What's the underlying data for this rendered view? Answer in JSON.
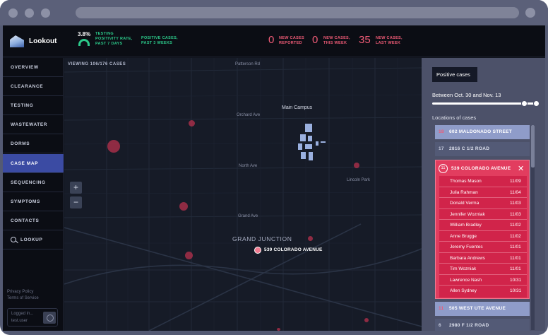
{
  "app": {
    "name": "Lookout"
  },
  "stats": {
    "positivity_value": "3.8%",
    "positivity_label": "TESTING POSITIVITY RATE, PAST 7 DAYS",
    "positive_cases_label": "POSITIVE CASES, PAST 3 WEEKS",
    "new_reported": {
      "value": "0",
      "label": "NEW CASES REPORTED"
    },
    "new_this_week": {
      "value": "0",
      "label": "NEW CASES, THIS WEEK"
    },
    "new_last_week": {
      "value": "35",
      "label": "NEW CASES, LAST WEEK"
    }
  },
  "nav": {
    "overview": "OVERVIEW",
    "clearance": "CLEARANCE",
    "testing": "TESTING",
    "wastewater": "WASTEWATER",
    "dorms": "DORMS",
    "case_map": "CASE MAP",
    "sequencing": "SEQUENCING",
    "symptoms": "SYMPTOMS",
    "contacts": "CONTACTS",
    "lookup": "LOOKUP",
    "active": "case_map"
  },
  "footer": {
    "privacy": "Privacy Policy",
    "terms": "Terms of Service",
    "logged_in": "Logged in...",
    "user": "test.user"
  },
  "map": {
    "viewing": "VIEWING 106/176 CASES",
    "streets": {
      "patterson": "Patterson Rd",
      "orchard": "Orchard Ave",
      "north": "North Ave",
      "lincoln": "Lincoln Park",
      "grand": "Grand Ave"
    },
    "main_campus": "Main Campus",
    "city": "GRAND JUNCTION",
    "selected_location": "539 COLORADO AVENUE",
    "zoom_in": "+",
    "zoom_out": "−"
  },
  "panel": {
    "tab": "Positive cases",
    "range": "Between Oct. 30 and Nov. 13",
    "locations_title": "Locations of cases",
    "rows": [
      {
        "count": "18",
        "name": "602 MALDONADO STREET"
      },
      {
        "count": "17",
        "name": "2816 C 1/2 ROAD"
      },
      {
        "count": "11",
        "name": "505 WEST UTE AVENUE"
      },
      {
        "count": "6",
        "name": "2980 F 1/2 ROAD"
      }
    ],
    "expanded": {
      "count": "11",
      "name": "539 COLORADO AVENUE",
      "close": "✕",
      "people": [
        {
          "name": "Thomas Mason",
          "date": "11/09"
        },
        {
          "name": "Julia Rahman",
          "date": "11/04"
        },
        {
          "name": "Donald Verma",
          "date": "11/03"
        },
        {
          "name": "Jennifer Wozniak",
          "date": "11/03"
        },
        {
          "name": "William Bradley",
          "date": "11/02"
        },
        {
          "name": "Anne Brugge",
          "date": "11/02"
        },
        {
          "name": "Jeremy Fuentes",
          "date": "11/01"
        },
        {
          "name": "Barbara Andrews",
          "date": "11/01"
        },
        {
          "name": "Tim Wozniak",
          "date": "11/01"
        },
        {
          "name": "Lawrence Nash",
          "date": "10/31"
        },
        {
          "name": "Allen Sydney",
          "date": "10/31"
        }
      ]
    }
  },
  "colors": {
    "accent_red": "#ef5b76",
    "accent_green": "#2cc98a",
    "nav_active": "#3b4ba3",
    "case_dot": "#b8314d"
  }
}
